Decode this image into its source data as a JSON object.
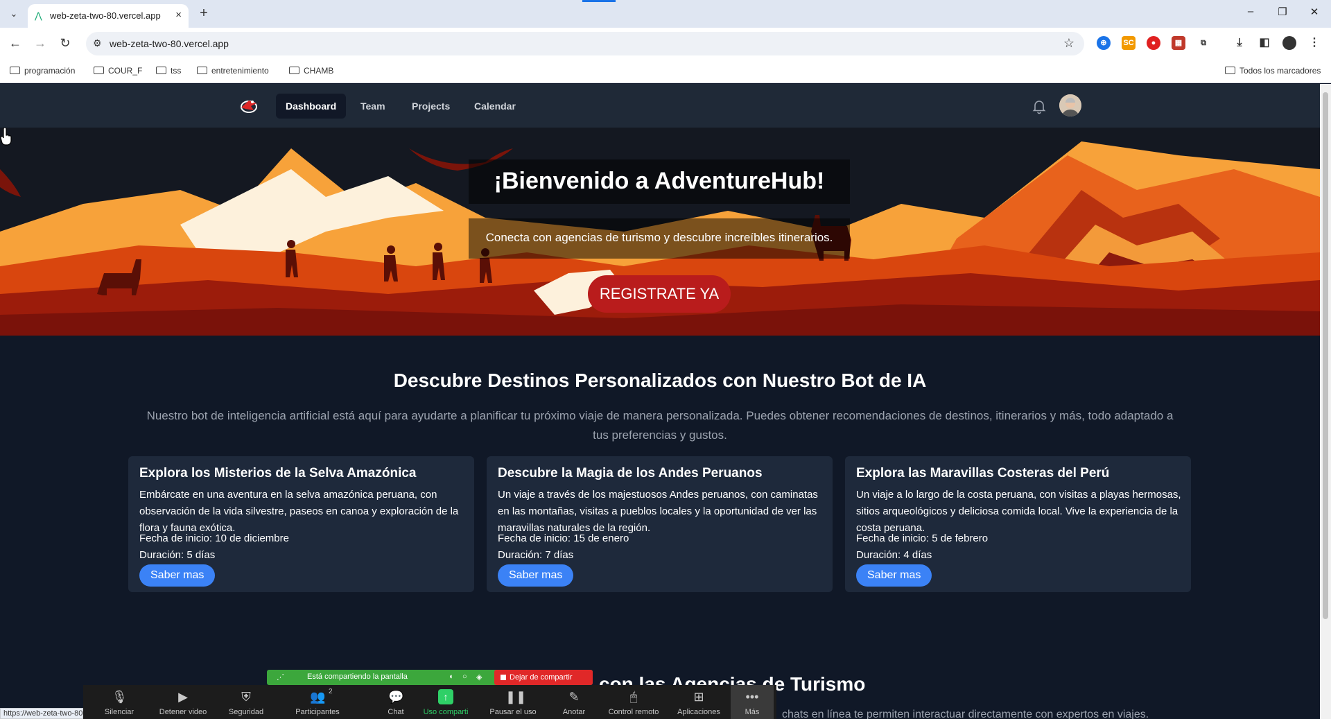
{
  "browser": {
    "tab_title": "web-zeta-two-80.vercel.app",
    "tab_close": "×",
    "new_tab": "+",
    "url": "web-zeta-two-80.vercel.app",
    "bookmarks": [
      "programación",
      "COUR_F",
      "tss",
      "entretenimiento",
      "CHAMB"
    ],
    "all_bookmarks": "Todos los marcadores",
    "status_url": "https://web-zeta-two-80.vercel.app/"
  },
  "nav": {
    "links": [
      "Dashboard",
      "Team",
      "Projects",
      "Calendar"
    ],
    "active": "Dashboard"
  },
  "hero": {
    "title": "¡Bienvenido a AdventureHub!",
    "subtitle": "Conecta con agencias de turismo y descubre increíbles itinerarios.",
    "cta": "REGISTRATE YA"
  },
  "section": {
    "title": "Descubre Destinos Personalizados con Nuestro Bot de IA",
    "description": "Nuestro bot de inteligencia artificial está aquí para ayudarte a planificar tu próximo viaje de manera personalizada. Puedes obtener recomendaciones de destinos, itinerarios y más, todo adaptado a tus preferencias y gustos."
  },
  "cards": [
    {
      "title": "Explora los Misterios de la Selva Amazónica",
      "description": "Embárcate en una aventura en la selva amazónica peruana, con observación de la vida silvestre, paseos en canoa y exploración de la flora y fauna exótica.",
      "date": "Fecha de inicio: 10 de diciembre",
      "duration": "Duración: 5 días",
      "button": "Saber mas"
    },
    {
      "title": "Descubre la Magia de los Andes Peruanos",
      "description": "Un viaje a través de los majestuosos Andes peruanos, con caminatas en las montañas, visitas a pueblos locales y la oportunidad de ver las maravillas naturales de la región.",
      "date": "Fecha de inicio: 15 de enero",
      "duration": "Duración: 7 días",
      "button": "Saber mas"
    },
    {
      "title": "Explora las Maravillas Costeras del Perú",
      "description": "Un viaje a lo largo de la costa peruana, con visitas a playas hermosas, sitios arqueológicos y deliciosa comida local. Vive la experiencia de la costa peruana.",
      "date": "Fecha de inicio: 5 de febrero",
      "duration": "Duración: 4 días",
      "button": "Saber mas"
    }
  ],
  "section2": {
    "title_visible": "con las Agencias de Turismo",
    "desc_visible": "chats en línea te permiten interactuar directamente con expertos en viajes."
  },
  "zoom": {
    "sharing_text": "Está compartiendo la pantalla",
    "stop_share": "Dejar de compartir",
    "participants_count": "2",
    "buttons": [
      {
        "label": "Silenciar",
        "icon": "microphone-icon"
      },
      {
        "label": "Detener video",
        "icon": "video-camera-icon"
      },
      {
        "label": "Seguridad",
        "icon": "shield-icon"
      },
      {
        "label": "Participantes",
        "icon": "participants-icon"
      },
      {
        "label": "Chat",
        "icon": "chat-icon"
      },
      {
        "label": "Uso comparti",
        "icon": "share-screen-icon"
      },
      {
        "label": "Pausar el uso",
        "icon": "pause-icon"
      },
      {
        "label": "Anotar",
        "icon": "pencil-icon"
      },
      {
        "label": "Control remoto",
        "icon": "mouse-icon"
      },
      {
        "label": "Aplicaciones",
        "icon": "apps-icon"
      },
      {
        "label": "Más",
        "icon": "more-icon"
      }
    ]
  },
  "colors": {
    "page_bg": "#101827",
    "navbar_bg": "#1f2937",
    "cta": "#b91c1c",
    "card_button": "#3b82f6",
    "zoom_green": "#3ca73c",
    "zoom_red": "#e02828"
  }
}
